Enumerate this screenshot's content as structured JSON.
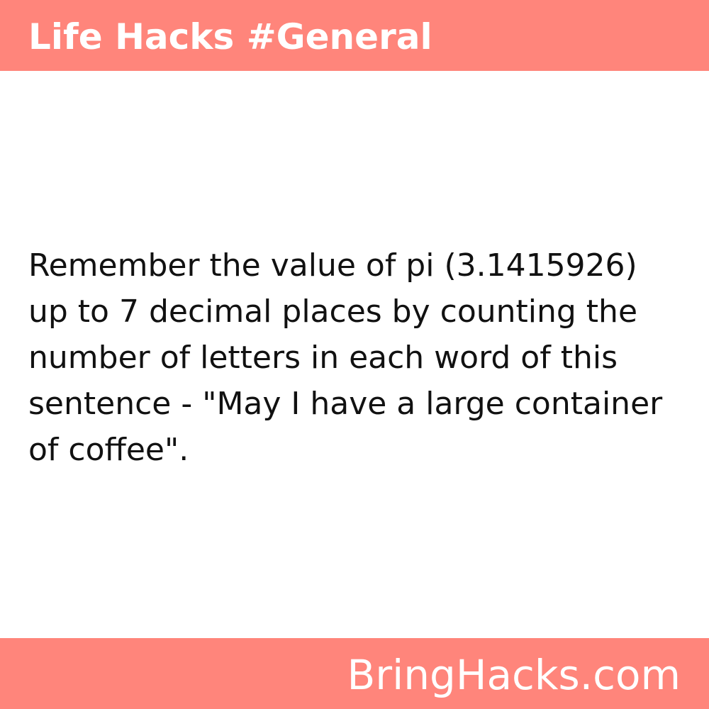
{
  "header": {
    "title": "Life Hacks #General"
  },
  "main": {
    "text": "Remember the value of pi (3.1415926) up to 7 decimal places by counting the number of letters in each word of this sentence - \"May I have a large container of coffee\"."
  },
  "footer": {
    "brand": "BringHacks.com"
  },
  "colors": {
    "accent": "#ff857b",
    "background": "#ffffff",
    "text": "#111111",
    "header_text": "#ffffff"
  }
}
